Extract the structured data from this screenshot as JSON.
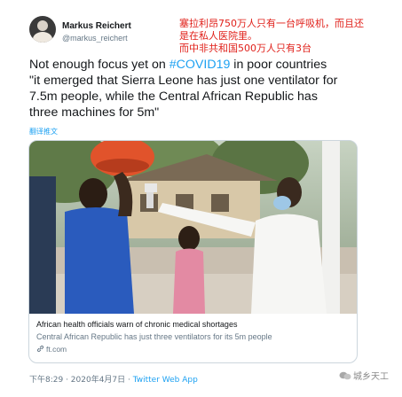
{
  "author": {
    "name": "Markus Reichert",
    "handle": "@markus_reichert"
  },
  "annotation": {
    "line1": "塞拉利昂750万人只有一台呼吸机，而且还",
    "line2": "是在私人医院里。",
    "line3": "而中非共和国500万人只有3台"
  },
  "tweet": {
    "line1_before": "Not enough focus yet on ",
    "hashtag": "#COVID19",
    "line1_after": " in poor countries",
    "line2": "\"it emerged that Sierra Leone has just one ventilator for",
    "line3": "7.5m people, while the Central African Republic has",
    "line4": "three machines for 5m\""
  },
  "translate_label": "翻译推文",
  "card": {
    "title": "African health officials warn of chronic medical shortages",
    "description": "Central African Republic has just three ventilators for its 5m people",
    "domain": "ft.com"
  },
  "meta": {
    "timestamp": "下午8:29 · 2020年4月7日 · ",
    "app": "Twitter Web App"
  },
  "watermark": "城乡天工",
  "colors": {
    "link_blue": "#1da1f2",
    "annotation_red": "#e0201a",
    "secondary_gray": "#657786"
  }
}
